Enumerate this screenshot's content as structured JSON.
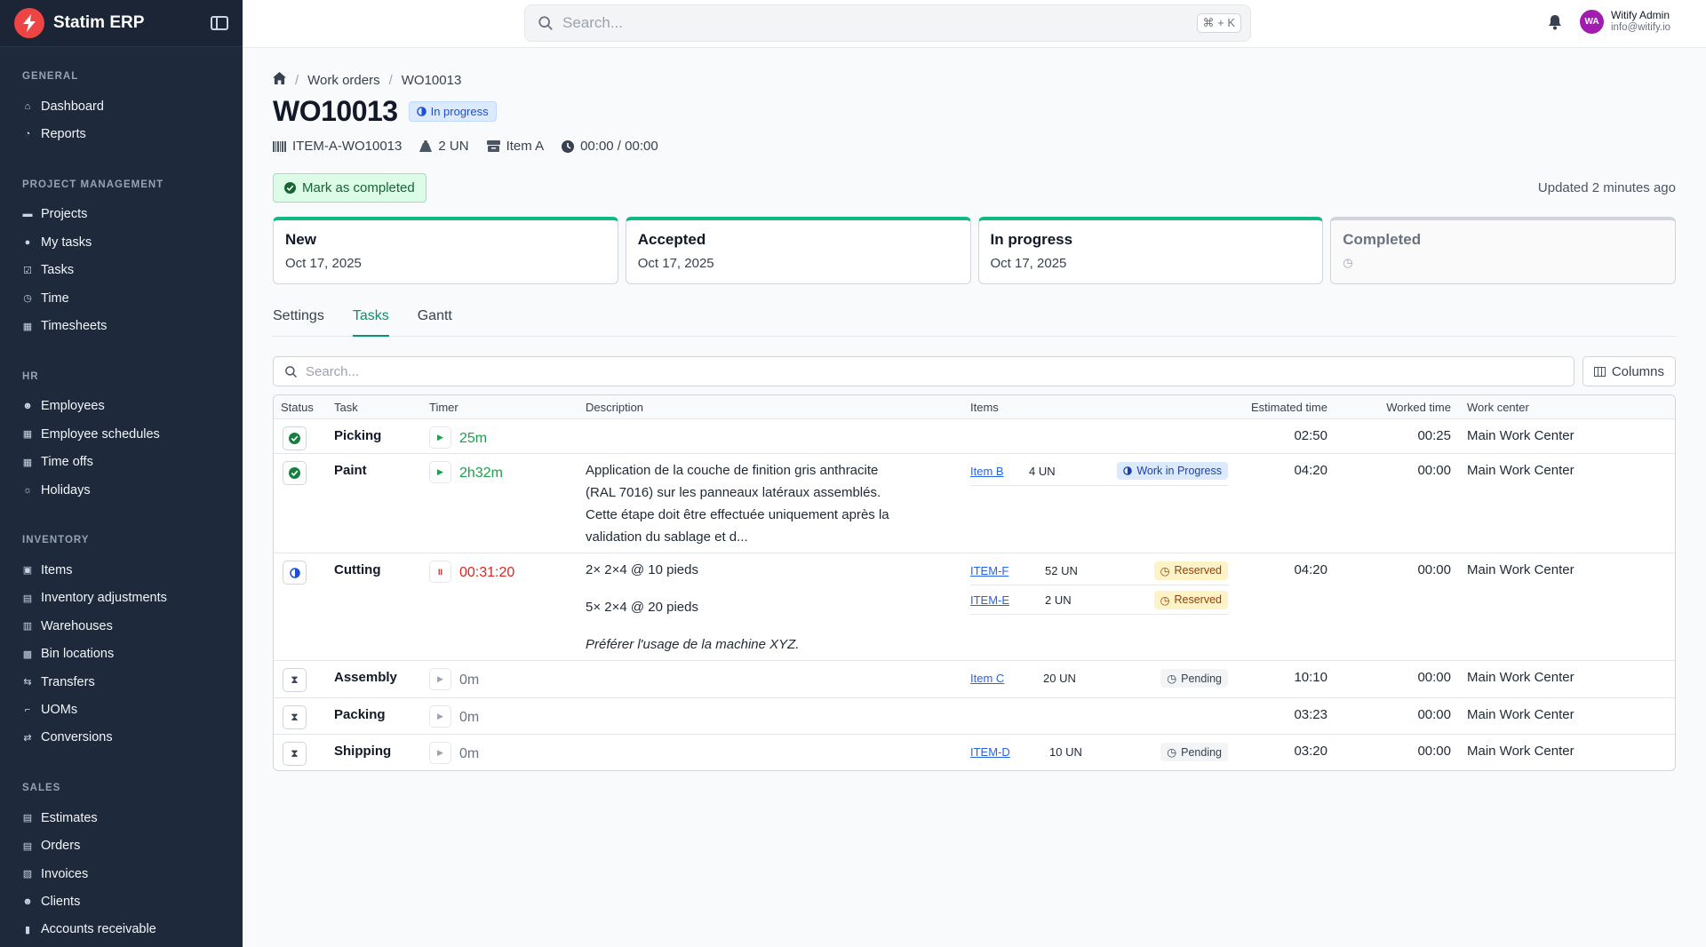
{
  "app": {
    "name": "Statim ERP"
  },
  "search": {
    "placeholder": "Search...",
    "shortcut": "⌘ + K"
  },
  "user": {
    "initials": "WA",
    "name": "Witify Admin",
    "email": "info@witify.io"
  },
  "sidebar": {
    "groups": [
      {
        "title": "GENERAL",
        "items": [
          {
            "label": "Dashboard",
            "icon": "home-icon"
          },
          {
            "label": "Reports",
            "icon": "pie-chart-icon"
          }
        ]
      },
      {
        "title": "PROJECT MANAGEMENT",
        "items": [
          {
            "label": "Projects",
            "icon": "folder-icon"
          },
          {
            "label": "My tasks",
            "icon": "user-circle-icon"
          },
          {
            "label": "Tasks",
            "icon": "tasks-icon"
          },
          {
            "label": "Time",
            "icon": "clock-icon"
          },
          {
            "label": "Timesheets",
            "icon": "calendar-icon"
          }
        ]
      },
      {
        "title": "HR",
        "items": [
          {
            "label": "Employees",
            "icon": "users-icon"
          },
          {
            "label": "Employee schedules",
            "icon": "calendar-icon"
          },
          {
            "label": "Time offs",
            "icon": "calendar-icon"
          },
          {
            "label": "Holidays",
            "icon": "sun-icon"
          }
        ]
      },
      {
        "title": "INVENTORY",
        "items": [
          {
            "label": "Items",
            "icon": "box-icon"
          },
          {
            "label": "Inventory adjustments",
            "icon": "adjust-icon"
          },
          {
            "label": "Warehouses",
            "icon": "building-icon"
          },
          {
            "label": "Bin locations",
            "icon": "bin-icon"
          },
          {
            "label": "Transfers",
            "icon": "transfer-icon"
          },
          {
            "label": "UOMs",
            "icon": "ruler-icon"
          },
          {
            "label": "Conversions",
            "icon": "convert-icon"
          }
        ]
      },
      {
        "title": "SALES",
        "items": [
          {
            "label": "Estimates",
            "icon": "document-icon"
          },
          {
            "label": "Orders",
            "icon": "document-icon"
          },
          {
            "label": "Invoices",
            "icon": "invoice-icon"
          },
          {
            "label": "Clients",
            "icon": "users-icon"
          },
          {
            "label": "Accounts receivable",
            "icon": "bar-chart-icon"
          }
        ]
      }
    ]
  },
  "breadcrumb": {
    "section": "Work orders",
    "current": "WO10013"
  },
  "header": {
    "title": "WO10013",
    "status": "In progress",
    "sku": "ITEM-A-WO10013",
    "quantity": "2 UN",
    "item": "Item A",
    "time": "00:00 / 00:00"
  },
  "actions": {
    "complete_label": "Mark as completed",
    "updated": "Updated 2 minutes ago"
  },
  "stages": [
    {
      "name": "New",
      "date": "Oct 17, 2025",
      "done": true
    },
    {
      "name": "Accepted",
      "date": "Oct 17, 2025",
      "done": true
    },
    {
      "name": "In progress",
      "date": "Oct 17, 2025",
      "done": true
    },
    {
      "name": "Completed",
      "date": "",
      "done": false
    }
  ],
  "tabs": {
    "settings": "Settings",
    "tasks": "Tasks",
    "gantt": "Gantt"
  },
  "table": {
    "search_placeholder": "Search...",
    "columns_label": "Columns",
    "headers": {
      "status": "Status",
      "task": "Task",
      "timer": "Timer",
      "description": "Description",
      "items": "Items",
      "estimated": "Estimated time",
      "worked": "Worked time",
      "work_center": "Work center"
    },
    "rows": [
      {
        "name": "Picking",
        "timer": "25m",
        "estimated": "02:50",
        "worked": "00:25",
        "work_center": "Main Work Center"
      },
      {
        "name": "Paint",
        "timer": "2h32m",
        "desc": "Application de la couche de finition gris anthracite (RAL 7016) sur les panneaux latéraux assemblés. Cette étape doit être effectuée uniquement après la validation du sablage et d...",
        "item": "Item B",
        "item_qty": "4 UN",
        "item_badge": "Work in Progress",
        "estimated": "04:20",
        "worked": "00:00",
        "work_center": "Main Work Center"
      },
      {
        "name": "Cutting",
        "timer": "00:31:20",
        "desc1": "2× 2×4 @ 10 pieds",
        "desc2": "5× 2×4 @ 20 pieds",
        "desc3": "Préférer l'usage de la machine XYZ.",
        "item1": "ITEM-F",
        "item1_qty": "52 UN",
        "item1_badge": "Reserved",
        "item2": "ITEM-E",
        "item2_qty": "2 UN",
        "item2_badge": "Reserved",
        "estimated": "04:20",
        "worked": "00:00",
        "work_center": "Main Work Center"
      },
      {
        "name": "Assembly",
        "timer": "0m",
        "item": "Item C",
        "item_qty": "20 UN",
        "item_badge": "Pending",
        "estimated": "10:10",
        "worked": "00:00",
        "work_center": "Main Work Center"
      },
      {
        "name": "Packing",
        "timer": "0m",
        "estimated": "03:23",
        "worked": "00:00",
        "work_center": "Main Work Center"
      },
      {
        "name": "Shipping",
        "timer": "0m",
        "item": "ITEM-D",
        "item_qty": "10 UN",
        "item_badge": "Pending",
        "estimated": "03:20",
        "worked": "00:00",
        "work_center": "Main Work Center"
      }
    ]
  },
  "colors": {
    "sidebar": "#1e293b",
    "accent": "#059669",
    "brand": "#ef4444"
  }
}
